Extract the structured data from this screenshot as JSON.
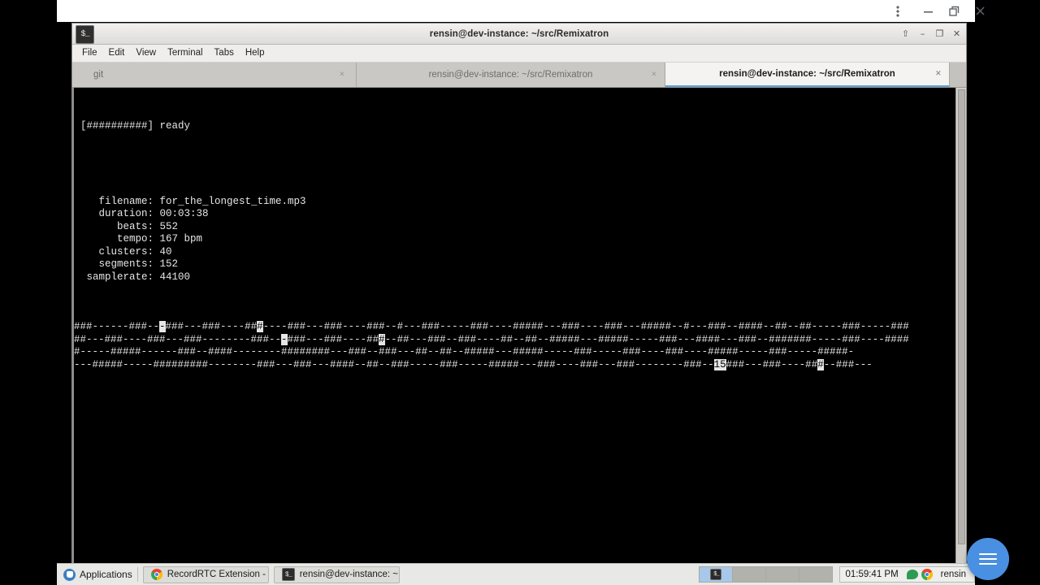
{
  "browser_chrome": {
    "menu_icon": "kebab-menu-icon",
    "minimize_label": "—",
    "restore_label": "❐",
    "close_label": "✕"
  },
  "terminal": {
    "window_title": "rensin@dev-instance: ~/src/Remixatron",
    "app_icon": "terminal-icon",
    "window_buttons": [
      {
        "name": "shade-button",
        "glyph": "⇧"
      },
      {
        "name": "minimize-button",
        "glyph": "–"
      },
      {
        "name": "maximize-button",
        "glyph": "❐"
      },
      {
        "name": "close-button",
        "glyph": "✕"
      }
    ],
    "menu": [
      "File",
      "Edit",
      "View",
      "Terminal",
      "Tabs",
      "Help"
    ],
    "tabs": [
      {
        "label": "git",
        "active": false,
        "close": "×"
      },
      {
        "label": "rensin@dev-instance: ~/src/Remixatron",
        "active": false,
        "close": "×"
      },
      {
        "label": "rensin@dev-instance: ~/src/Remixatron",
        "active": true,
        "close": "×"
      }
    ],
    "output": {
      "progress_line": "[##########] ready",
      "fields": [
        {
          "label": "filename:",
          "value": "for_the_longest_time.mp3"
        },
        {
          "label": "duration:",
          "value": "00:03:38"
        },
        {
          "label": "beats:",
          "value": "552"
        },
        {
          "label": "tempo:",
          "value": "167 bpm"
        },
        {
          "label": "clusters:",
          "value": "40"
        },
        {
          "label": "segments:",
          "value": "152"
        },
        {
          "label": "samplerate:",
          "value": "44100"
        }
      ],
      "info_block": "   filename: for_the_longest_time.mp3\n   duration: 00:03:38\n      beats: 552\n      tempo: 167 bpm\n   clusters: 40\n   segments: 152\n samplerate: 44100"
    },
    "beatmap": {
      "rows": [
        [
          {
            "t": "###------###--",
            "inv": false
          },
          {
            "t": "-",
            "inv": true
          },
          {
            "t": "###---###----##",
            "inv": false
          },
          {
            "t": "#",
            "inv": true
          },
          {
            "t": "----###---###----###--#---###-----###----#####---###----###---#####--#---###--####--##--##-----###-----###",
            "inv": false
          }
        ],
        [
          {
            "t": "##---###----###---###--------###--",
            "inv": false
          },
          {
            "t": "-",
            "inv": true
          },
          {
            "t": "###---###----##",
            "inv": false
          },
          {
            "t": "#",
            "inv": true
          },
          {
            "t": "--##---###--###----##--##--#####---#####-----###---####---###--#######-----###----####",
            "inv": false
          }
        ],
        [
          {
            "t": "#-----#####------###--####--------########---###--###---##--##--#####---#####-----###-----###----###----#####-----###-----#####-",
            "inv": false
          }
        ],
        [
          {
            "t": "---#####-----#########--------###---###---####--##--###-----###-----#####---###----###---###--------###--",
            "inv": false
          },
          {
            "t": "15",
            "inv": true
          },
          {
            "t": "###---###----##",
            "inv": false
          },
          {
            "t": "#",
            "inv": true
          },
          {
            "t": "--###---",
            "inv": false
          }
        ]
      ]
    },
    "scrollbar": {
      "name": "terminal-scrollbar"
    }
  },
  "taskbar": {
    "applications_label": "Applications",
    "applications_icon": "applications-menu-icon",
    "tasks": [
      {
        "icon": "chrome-icon",
        "label": "RecordRTC Extension - ..."
      },
      {
        "icon": "terminal-icon",
        "label": "rensin@dev-instance: ~..."
      }
    ],
    "workspaces": [
      {
        "name": "workspace-1",
        "active": true
      },
      {
        "name": "workspace-2",
        "active": false
      },
      {
        "name": "workspace-3",
        "active": false
      },
      {
        "name": "workspace-4",
        "active": false
      }
    ],
    "clock": "01:59:41 PM",
    "tray": [
      {
        "name": "messages-icon"
      },
      {
        "name": "chrome-icon"
      }
    ],
    "user": "rensin"
  },
  "fab": {
    "name": "menu-fab",
    "icon": "hamburger-menu-icon",
    "color": "#4a90e2"
  }
}
